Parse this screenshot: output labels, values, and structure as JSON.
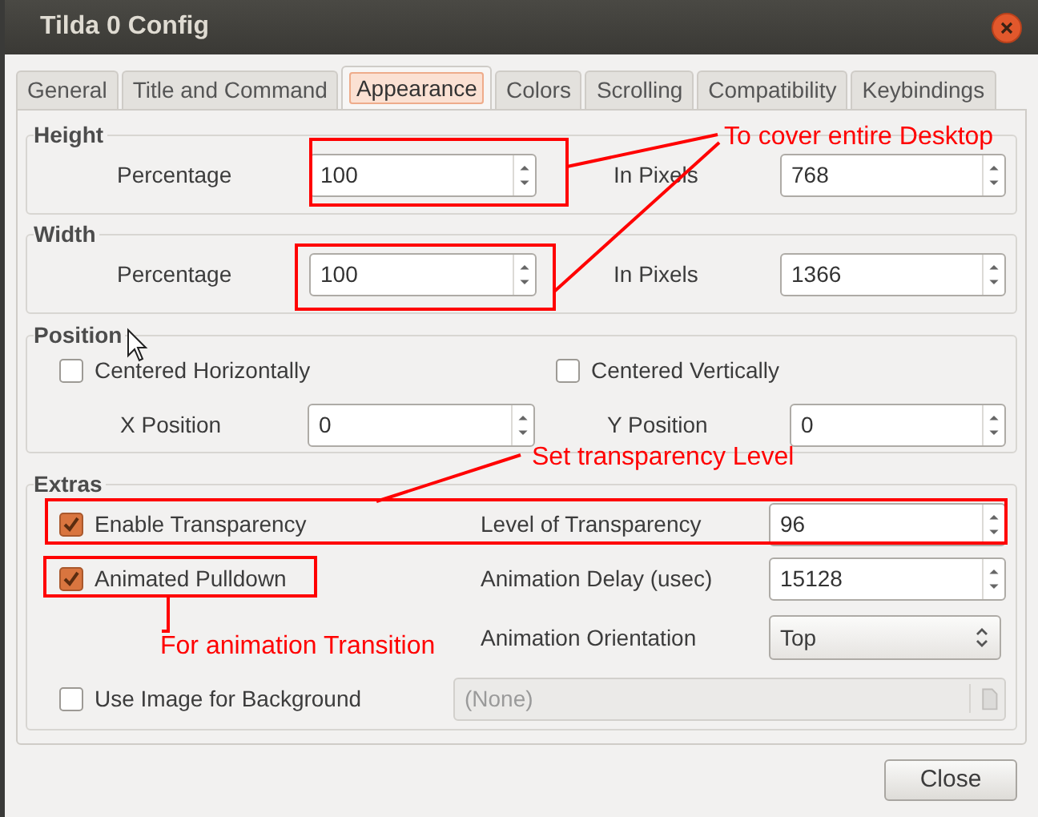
{
  "window": {
    "title": "Tilda 0 Config"
  },
  "tabs": [
    {
      "label": "General",
      "selected": false
    },
    {
      "label": "Title and Command",
      "selected": false
    },
    {
      "label": "Appearance",
      "selected": true
    },
    {
      "label": "Colors",
      "selected": false
    },
    {
      "label": "Scrolling",
      "selected": false
    },
    {
      "label": "Compatibility",
      "selected": false
    },
    {
      "label": "Keybindings",
      "selected": false
    }
  ],
  "height": {
    "title": "Height",
    "fields": [
      {
        "label": "Percentage",
        "value": "100"
      },
      {
        "label": "In Pixels",
        "value": "768"
      }
    ]
  },
  "width": {
    "title": "Width",
    "fields": [
      {
        "label": "Percentage",
        "value": "100"
      },
      {
        "label": "In Pixels",
        "value": "1366"
      }
    ]
  },
  "position": {
    "title": "Position",
    "checkboxes": [
      {
        "label": "Centered Horizontally",
        "checked": false
      },
      {
        "label": "Centered Vertically",
        "checked": false
      }
    ],
    "fields": [
      {
        "label": "X Position",
        "value": "0"
      },
      {
        "label": "Y Position",
        "value": "0"
      }
    ]
  },
  "extras": {
    "title": "Extras",
    "rows": [
      {
        "checkbox": {
          "label": "Enable Transparency",
          "checked": true
        },
        "control": {
          "kind": "spin",
          "label": "Level of Transparency",
          "value": "96"
        }
      },
      {
        "checkbox": {
          "label": "Animated Pulldown",
          "checked": true
        },
        "control": {
          "kind": "spin",
          "label": "Animation Delay (usec)",
          "value": "15128"
        }
      },
      {
        "control": {
          "kind": "combo",
          "label": "Animation Orientation",
          "value": "Top"
        }
      },
      {
        "checkbox": {
          "label": "Use Image for Background",
          "checked": false
        },
        "control": {
          "kind": "file",
          "value": "(None)",
          "disabled": true
        }
      }
    ]
  },
  "annotations": [
    {
      "text": "To cover entire Desktop"
    },
    {
      "text": "Set transparency Level"
    },
    {
      "text": "For animation Transition"
    }
  ],
  "buttons": [
    {
      "label": "Close"
    }
  ]
}
